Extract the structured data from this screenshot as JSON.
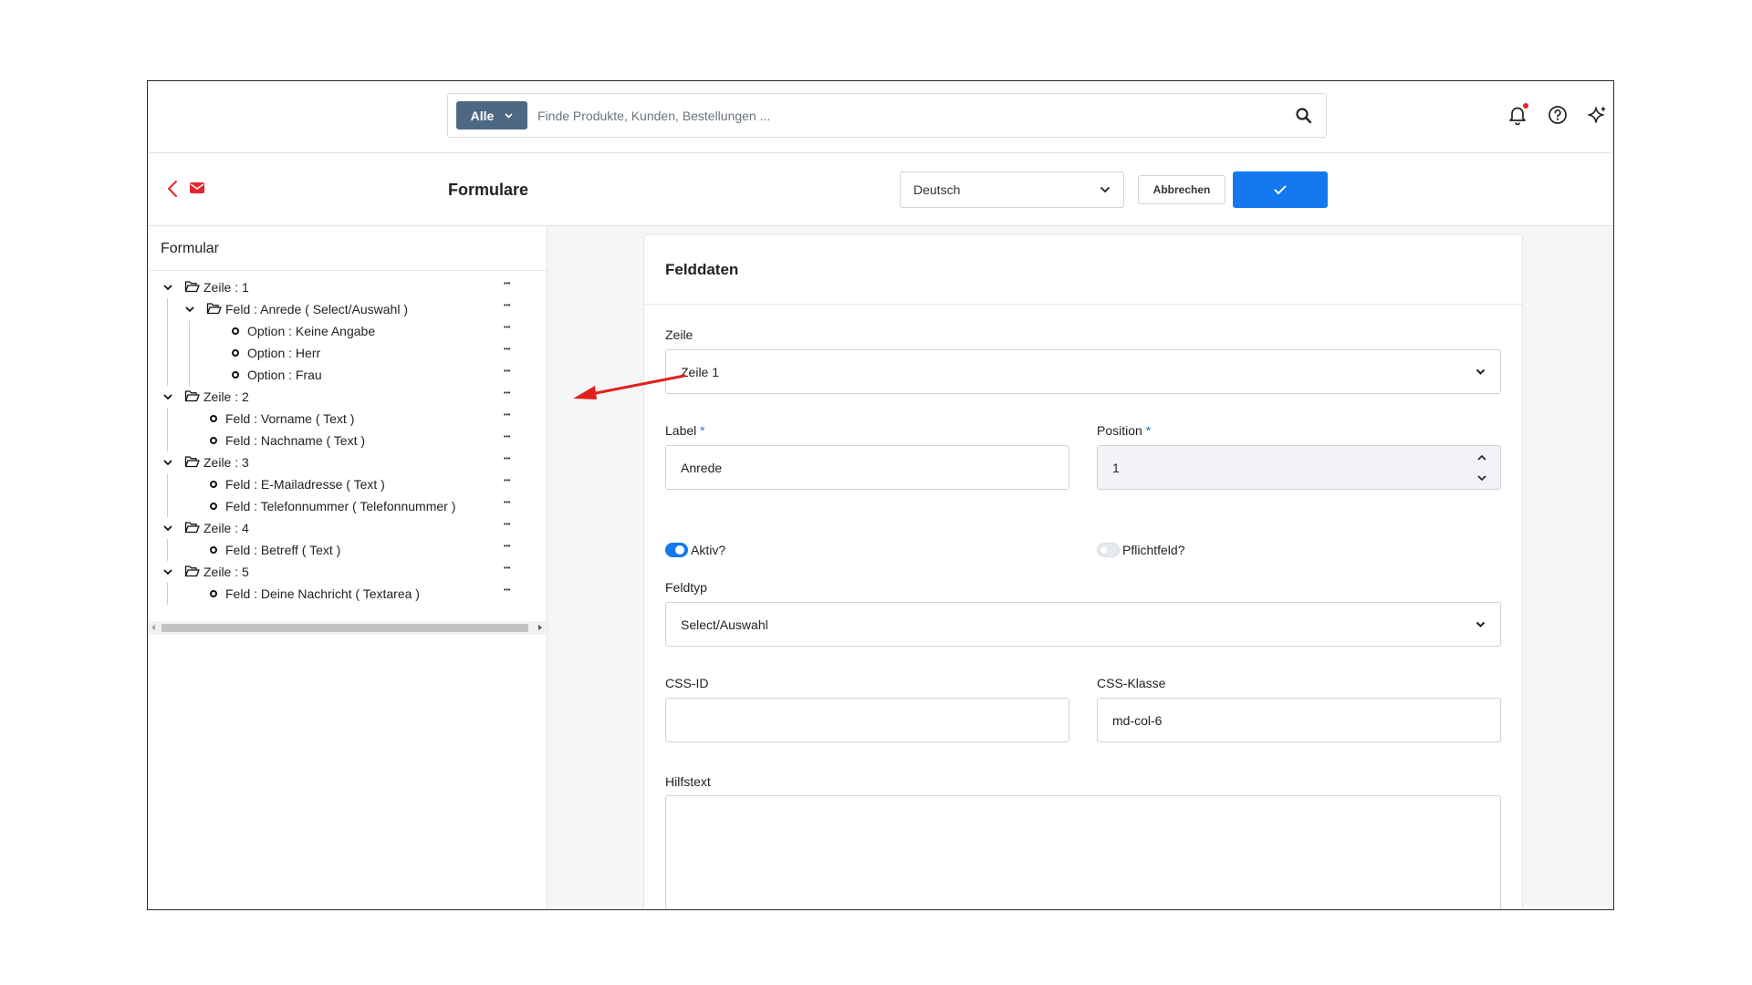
{
  "topbar": {
    "search_category": "Alle",
    "search_placeholder": "Finde Produkte, Kunden, Bestellungen ..."
  },
  "subbar": {
    "title": "Formulare",
    "language": "Deutsch",
    "cancel_label": "Abbrechen"
  },
  "form_tree": {
    "heading": "Formular",
    "rows": [
      {
        "label": "Zeile : 1",
        "level": 0,
        "type": "folder"
      },
      {
        "label": "Feld : Anrede ( Select/Auswahl )",
        "level": 1,
        "type": "folder"
      },
      {
        "label": "Option : Keine Angabe",
        "level": 2,
        "type": "leaf"
      },
      {
        "label": "Option : Herr",
        "level": 2,
        "type": "leaf"
      },
      {
        "label": "Option : Frau",
        "level": 2,
        "type": "leaf"
      },
      {
        "label": "Zeile : 2",
        "level": 0,
        "type": "folder"
      },
      {
        "label": "Feld : Vorname ( Text )",
        "level": 1,
        "type": "leaf"
      },
      {
        "label": "Feld : Nachname ( Text )",
        "level": 1,
        "type": "leaf"
      },
      {
        "label": "Zeile : 3",
        "level": 0,
        "type": "folder"
      },
      {
        "label": "Feld : E-Mailadresse ( Text )",
        "level": 1,
        "type": "leaf"
      },
      {
        "label": "Feld : Telefonnummer ( Telefonnummer )",
        "level": 1,
        "type": "leaf"
      },
      {
        "label": "Zeile : 4",
        "level": 0,
        "type": "folder"
      },
      {
        "label": "Feld : Betreff ( Text )",
        "level": 1,
        "type": "leaf"
      },
      {
        "label": "Zeile : 5",
        "level": 0,
        "type": "folder"
      },
      {
        "label": "Feld : Deine Nachricht ( Textarea )",
        "level": 1,
        "type": "leaf"
      }
    ]
  },
  "field_data": {
    "heading": "Felddaten",
    "row_label": "Zeile",
    "row_value": "Zeile 1",
    "label_label": "Label",
    "label_value": "Anrede",
    "position_label": "Position",
    "position_value": "1",
    "required_marker": "*",
    "active_label": "Aktiv?",
    "active_on": true,
    "mandatory_label": "Pflichtfeld?",
    "mandatory_on": false,
    "fieldtype_label": "Feldtyp",
    "fieldtype_value": "Select/Auswahl",
    "css_id_label": "CSS-ID",
    "css_id_value": "",
    "css_class_label": "CSS-Klasse",
    "css_class_value": "md-col-6",
    "helptext_label": "Hilfstext",
    "helptext_value": ""
  },
  "colors": {
    "primary": "#1479ef",
    "category_button": "#4e6883",
    "accent_red": "#e5252f",
    "annotation_arrow": "#e0201c"
  }
}
